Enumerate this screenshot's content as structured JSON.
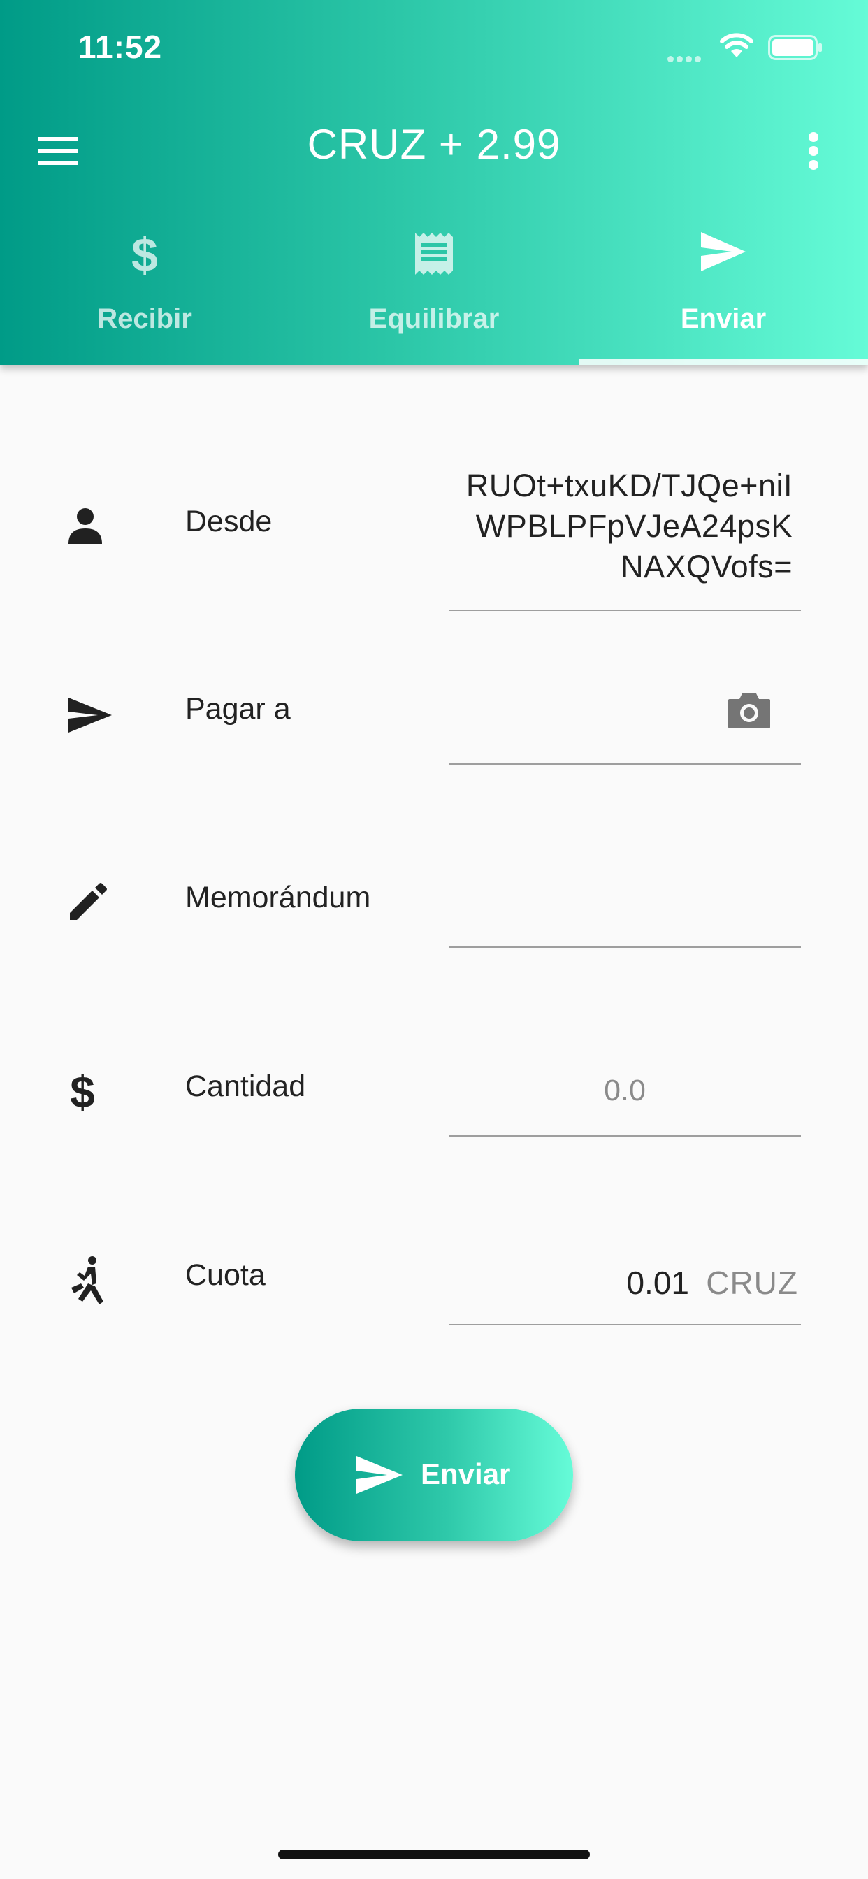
{
  "status_bar": {
    "time": "11:52"
  },
  "app_bar": {
    "title": "CRUZ + 2.99",
    "menu_icon": "hamburger-menu-icon",
    "more_icon": "more-vertical-icon"
  },
  "tabs": [
    {
      "label": "Recibir",
      "icon": "dollar-icon",
      "active": false
    },
    {
      "label": "Equilibrar",
      "icon": "receipt-icon",
      "active": false
    },
    {
      "label": "Enviar",
      "icon": "send-icon",
      "active": true
    }
  ],
  "form": {
    "from": {
      "label": "Desde",
      "icon": "person-icon",
      "value": "RUOt+txuKD/TJQe+niIWPBLPFpVJeA24psKNAXQVofs="
    },
    "pay_to": {
      "label": "Pagar a",
      "icon": "send-icon",
      "value": "",
      "camera_icon": "camera-icon"
    },
    "memo": {
      "label": "Memorándum",
      "icon": "pencil-icon",
      "value": ""
    },
    "amount": {
      "label": "Cantidad",
      "icon": "dollar-icon",
      "placeholder": "0.0"
    },
    "fee": {
      "label": "Cuota",
      "icon": "walking-icon",
      "value": "0.01",
      "unit": "CRUZ"
    }
  },
  "send_button": {
    "label": "Enviar",
    "icon": "send-icon"
  },
  "colors": {
    "gradient_start": "#009b87",
    "gradient_end": "#65fbd7",
    "background": "#fafafa"
  }
}
